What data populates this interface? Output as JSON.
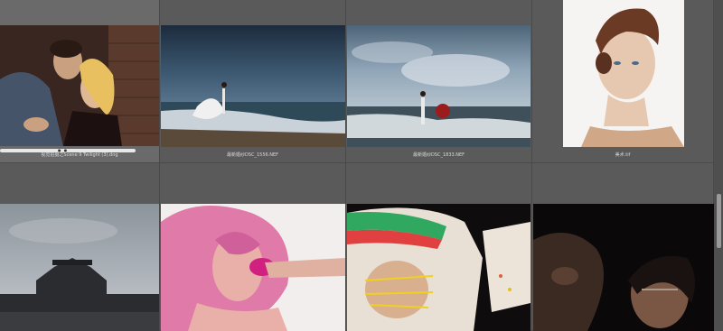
{
  "thumbnails": [
    {
      "filename": "视觉拍摄之Scene 9 Twilight (3).dng",
      "subject": "couple-against-brick-wall"
    },
    {
      "filename": "最新婚纱DSC_1556.NEF",
      "subject": "bride-on-beach-at-dusk"
    },
    {
      "filename": "最新婚纱DSC_1833.NEF",
      "subject": "bride-with-red-umbrella-on-shore"
    },
    {
      "filename": "美术.tif",
      "subject": "portrait-woman-updo"
    },
    {
      "filename": "",
      "subject": "city-gate-silhouette"
    },
    {
      "filename": "",
      "subject": "pink-hair-portrait"
    },
    {
      "filename": "",
      "subject": "painted-face-headwrap"
    },
    {
      "filename": "",
      "subject": "dark-studio-portrait"
    }
  ],
  "loading": {
    "progress": 1.0
  },
  "colors": {
    "background": "#595959",
    "label": "#d9d9d9"
  }
}
